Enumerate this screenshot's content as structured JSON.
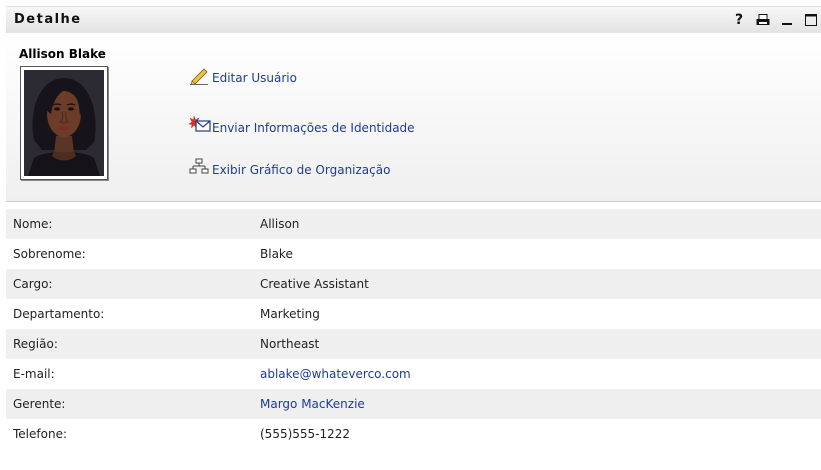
{
  "panel": {
    "title": "Detalhe",
    "icons": [
      "help-icon",
      "print-icon",
      "minimize-icon",
      "maximize-icon"
    ],
    "help_label": "?"
  },
  "user": {
    "name": "Allison Blake"
  },
  "actions": [
    {
      "label": "Editar Usuário",
      "icon": "pencil-icon"
    },
    {
      "label": "Enviar Informações de Identidade",
      "icon": "envelope-icon"
    },
    {
      "label": "Exibir Gráfico de Organização",
      "icon": "org-chart-icon"
    }
  ],
  "details": [
    {
      "key": "Nome:",
      "value": "Allison"
    },
    {
      "key": "Sobrenome:",
      "value": "Blake"
    },
    {
      "key": "Cargo:",
      "value": "Creative Assistant"
    },
    {
      "key": "Departamento:",
      "value": "Marketing"
    },
    {
      "key": "Região:",
      "value": "Northeast"
    },
    {
      "key": "E-mail:",
      "value": "ablake@whateverco.com",
      "link": true
    },
    {
      "key": "Gerente:",
      "value": "Margo MacKenzie",
      "link": true
    },
    {
      "key": "Telefone:",
      "value": "(555)555-1222"
    }
  ],
  "colors": {
    "link": "#1f3c8f",
    "alt_row": "#efefef"
  }
}
